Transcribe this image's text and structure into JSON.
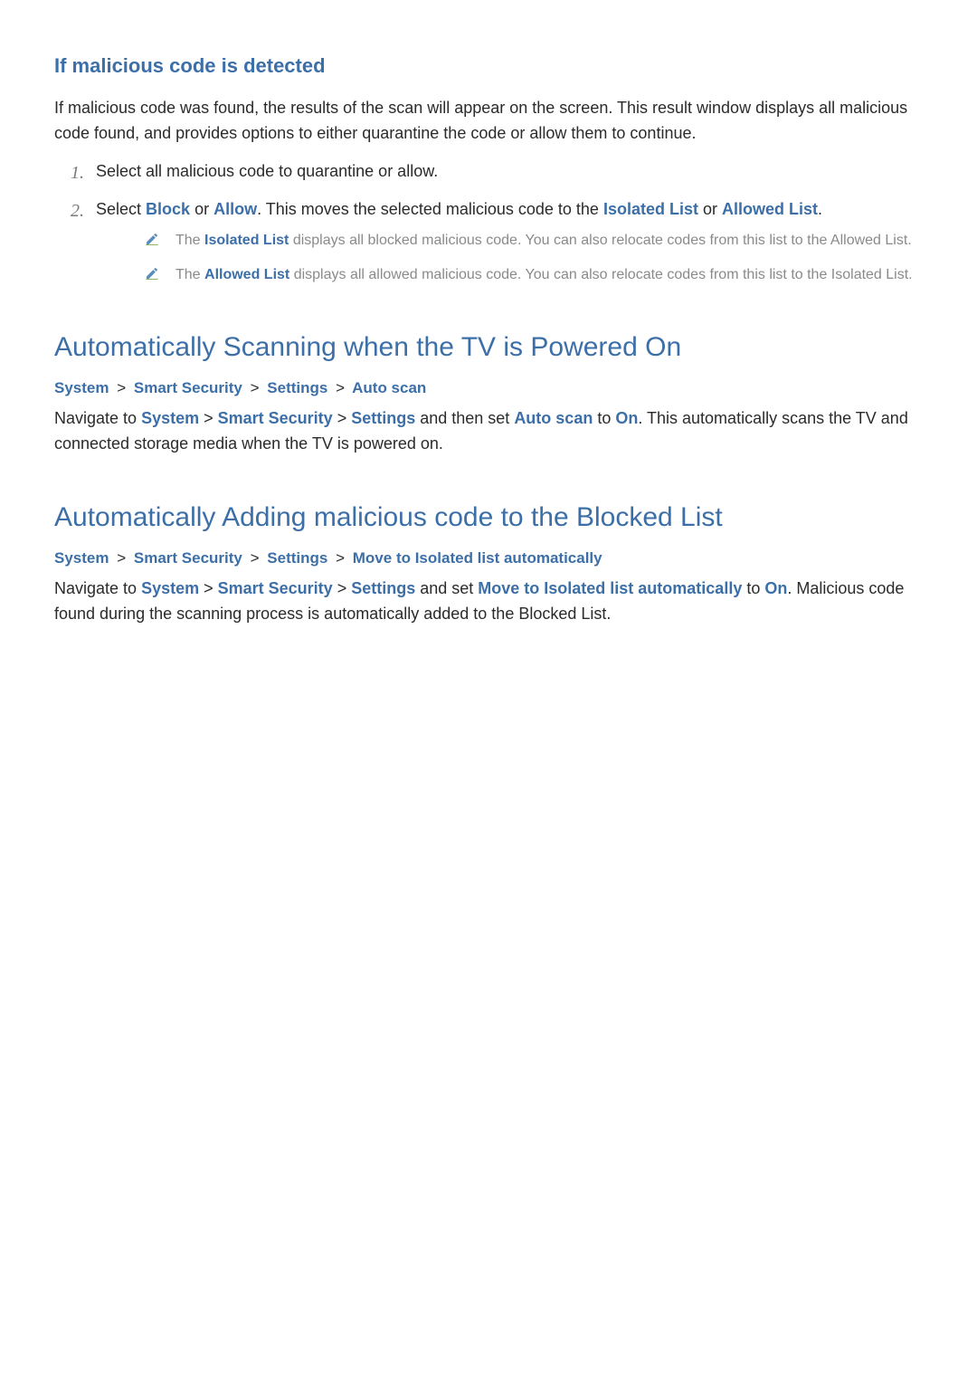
{
  "section1": {
    "heading": "If malicious code is detected",
    "intro": "If malicious code was found, the results of the scan will appear on the screen. This result window displays all malicious code found, and provides options to either quarantine the code or allow them to continue.",
    "step1_num": "1.",
    "step1_text": "Select all malicious code to quarantine or allow.",
    "step2_num": "2.",
    "step2_a": "Select ",
    "step2_block": "Block",
    "step2_or": " or ",
    "step2_allow": "Allow",
    "step2_b": ". This moves the selected malicious code to the ",
    "step2_isolated": "Isolated List",
    "step2_or2": " or ",
    "step2_allowed": "Allowed List",
    "step2_c": ".",
    "note1_a": "The ",
    "note1_term": "Isolated List",
    "note1_b": " displays all blocked malicious code. You can also relocate codes from this list to the Allowed List.",
    "note2_a": "The ",
    "note2_term": "Allowed List",
    "note2_b": " displays all allowed malicious code. You can also relocate codes from this list to the Isolated List."
  },
  "section2": {
    "title": "Automatically Scanning when the TV is Powered On",
    "bc1": "System",
    "bc2": "Smart Security",
    "bc3": "Settings",
    "bc4": "Auto scan",
    "sep": ">",
    "p_a": "Navigate to ",
    "p_system": "System",
    "p_sep1": " > ",
    "p_ss": "Smart Security",
    "p_sep2": " > ",
    "p_settings": "Settings",
    "p_b": " and then set ",
    "p_auto": "Auto scan",
    "p_c": " to ",
    "p_on": "On",
    "p_d": ". This automatically scans the TV and connected storage media when the TV is powered on."
  },
  "section3": {
    "title": "Automatically Adding malicious code to the Blocked List",
    "bc1": "System",
    "bc2": "Smart Security",
    "bc3": "Settings",
    "bc4": "Move to Isolated list automatically",
    "sep": ">",
    "p_a": "Navigate to ",
    "p_system": "System",
    "p_sep1": " > ",
    "p_ss": "Smart Security",
    "p_sep2": " > ",
    "p_settings": "Settings",
    "p_b": " and set ",
    "p_move": "Move to Isolated list automatically",
    "p_c": " to ",
    "p_on": "On",
    "p_d": ". Malicious code found during the scanning process is automatically added to the Blocked List."
  }
}
